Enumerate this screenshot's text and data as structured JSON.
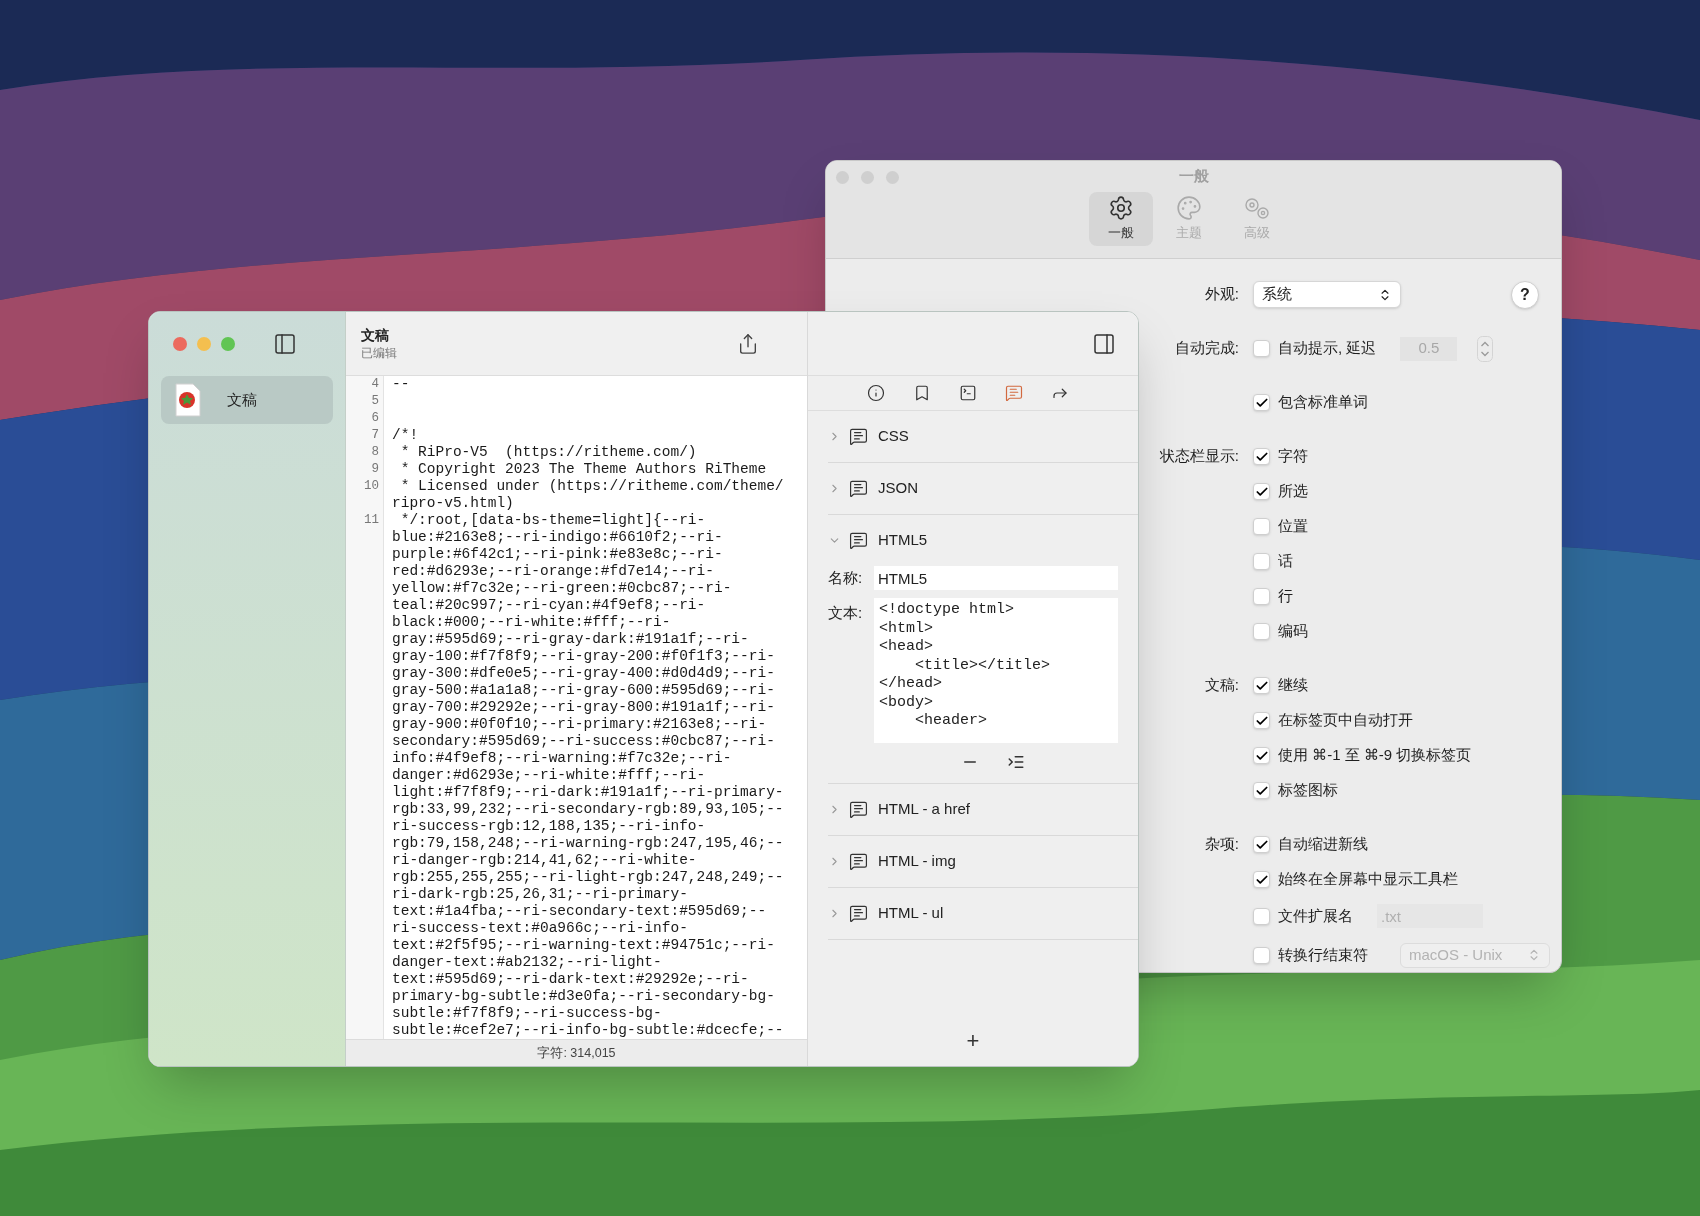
{
  "settings_window": {
    "title": "一般",
    "tabs": [
      {
        "kind": "general",
        "label": "一般",
        "selected": true
      },
      {
        "kind": "theme",
        "label": "主题",
        "selected": false
      },
      {
        "kind": "advanced",
        "label": "高级",
        "selected": false
      }
    ],
    "help": "?",
    "groups": [
      {
        "label": "外观:",
        "items": [
          {
            "kind": "popup",
            "value": "系统"
          }
        ]
      },
      {
        "label": "自动完成:",
        "items": [
          {
            "kind": "checkbox_stepper",
            "label": "自动提示, 延迟",
            "checked": false,
            "value": "0.5"
          },
          {
            "kind": "checkbox",
            "label": "包含标准单词",
            "checked": true
          }
        ]
      },
      {
        "label": "状态栏显示:",
        "items": [
          {
            "kind": "checkbox",
            "label": "字符",
            "checked": true
          },
          {
            "kind": "checkbox",
            "label": "所选",
            "checked": true
          },
          {
            "kind": "checkbox",
            "label": "位置",
            "checked": false
          },
          {
            "kind": "checkbox",
            "label": "话",
            "checked": false
          },
          {
            "kind": "checkbox",
            "label": "行",
            "checked": false
          },
          {
            "kind": "checkbox",
            "label": "编码",
            "checked": false
          }
        ]
      },
      {
        "label": "文稿:",
        "items": [
          {
            "kind": "checkbox",
            "label": "继续",
            "checked": true
          },
          {
            "kind": "checkbox",
            "label": "在标签页中自动打开",
            "checked": true
          },
          {
            "kind": "checkbox",
            "label": "使用 ⌘-1 至 ⌘-9 切换标签页",
            "checked": true
          },
          {
            "kind": "checkbox",
            "label": "标签图标",
            "checked": true
          }
        ]
      },
      {
        "label": "杂项:",
        "items": [
          {
            "kind": "checkbox",
            "label": "自动缩进新线",
            "checked": true
          },
          {
            "kind": "checkbox",
            "label": "始终在全屏幕中显示工具栏",
            "checked": true
          },
          {
            "kind": "checkbox_field",
            "label": "文件扩展名",
            "checked": false,
            "placeholder": ".txt"
          },
          {
            "kind": "checkbox_popup",
            "label": "转换行结束符",
            "checked": false,
            "value": "macOS - Unix"
          }
        ]
      }
    ]
  },
  "main_window": {
    "sidebar": {
      "items": [
        {
          "label": "文稿",
          "selected": true
        }
      ]
    },
    "editor": {
      "title": "文稿",
      "subtitle": "已编辑",
      "lines": [
        {
          "number": "4",
          "segments": [
            "--"
          ]
        },
        {
          "number": "5"
        },
        {
          "number": "6"
        },
        {
          "number": "7",
          "segments": [
            "/*!"
          ]
        },
        {
          "number": "8",
          "segments": [
            " * RiPro-V5  (https://ritheme.com/)"
          ]
        },
        {
          "number": "9",
          "segments": [
            " * Copyright 2023 The Theme Authors RiTheme"
          ]
        },
        {
          "number": "10",
          "segments": [
            " * Licensed under (https://ritheme.com/theme/",
            "ripro-v5.html)"
          ]
        },
        {
          "number": "11",
          "segments": [
            " */:root,[data-bs-theme=light]{--ri-",
            "blue:#2163e8;--ri-indigo:#6610f2;--ri-",
            "purple:#6f42c1;--ri-pink:#e83e8c;--ri-",
            "red:#d6293e;--ri-orange:#fd7e14;--ri-",
            "yellow:#f7c32e;--ri-green:#0cbc87;--ri-",
            "teal:#20c997;--ri-cyan:#4f9ef8;--ri-",
            "black:#000;--ri-white:#fff;--ri-",
            "gray:#595d69;--ri-gray-dark:#191a1f;--ri-",
            "gray-100:#f7f8f9;--ri-gray-200:#f0f1f3;--ri-",
            "gray-300:#dfe0e5;--ri-gray-400:#d0d4d9;--ri-",
            "gray-500:#a1a1a8;--ri-gray-600:#595d69;--ri-",
            "gray-700:#29292e;--ri-gray-800:#191a1f;--ri-",
            "gray-900:#0f0f10;--ri-primary:#2163e8;--ri-",
            "secondary:#595d69;--ri-success:#0cbc87;--ri-",
            "info:#4f9ef8;--ri-warning:#f7c32e;--ri-",
            "danger:#d6293e;--ri-white:#fff;--ri-",
            "light:#f7f8f9;--ri-dark:#191a1f;--ri-primary-",
            "rgb:33,99,232;--ri-secondary-rgb:89,93,105;--",
            "ri-success-rgb:12,188,135;--ri-info-",
            "rgb:79,158,248;--ri-warning-rgb:247,195,46;--",
            "ri-danger-rgb:214,41,62;--ri-white-",
            "rgb:255,255,255;--ri-light-rgb:247,248,249;--",
            "ri-dark-rgb:25,26,31;--ri-primary-",
            "text:#1a4fba;--ri-secondary-text:#595d69;--",
            "ri-success-text:#0a966c;--ri-info-",
            "text:#2f5f95;--ri-warning-text:#94751c;--ri-",
            "danger-text:#ab2132;--ri-light-",
            "text:#595d69;--ri-dark-text:#29292e;--ri-",
            "primary-bg-subtle:#d3e0fa;--ri-secondary-bg-",
            "subtle:#f7f8f9;--ri-success-bg-",
            "subtle:#cef2e7;--ri-info-bg-subtle:#dcecfe;--"
          ]
        }
      ],
      "status": "字符: 314,015"
    },
    "inspector": {
      "tools": [
        {
          "kind": "info",
          "selected": false
        },
        {
          "kind": "bookmark",
          "selected": false
        },
        {
          "kind": "terminal",
          "selected": false
        },
        {
          "kind": "snippets",
          "selected": true
        },
        {
          "kind": "share",
          "selected": false
        }
      ],
      "snippets": [
        {
          "label": "CSS",
          "expanded": false
        },
        {
          "label": "JSON",
          "expanded": false
        },
        {
          "label": "HTML5",
          "expanded": true,
          "name_label": "名称:",
          "name_value": "HTML5",
          "text_label": "文本:",
          "text": [
            "<!doctype html>",
            "<html>",
            "<head>",
            "    <title></title>",
            "</head>",
            "<body>",
            "    <header>"
          ]
        },
        {
          "label": "HTML - a href",
          "expanded": false
        },
        {
          "label": "HTML - img",
          "expanded": false
        },
        {
          "label": "HTML - ul",
          "expanded": false
        }
      ],
      "add": "+"
    }
  }
}
